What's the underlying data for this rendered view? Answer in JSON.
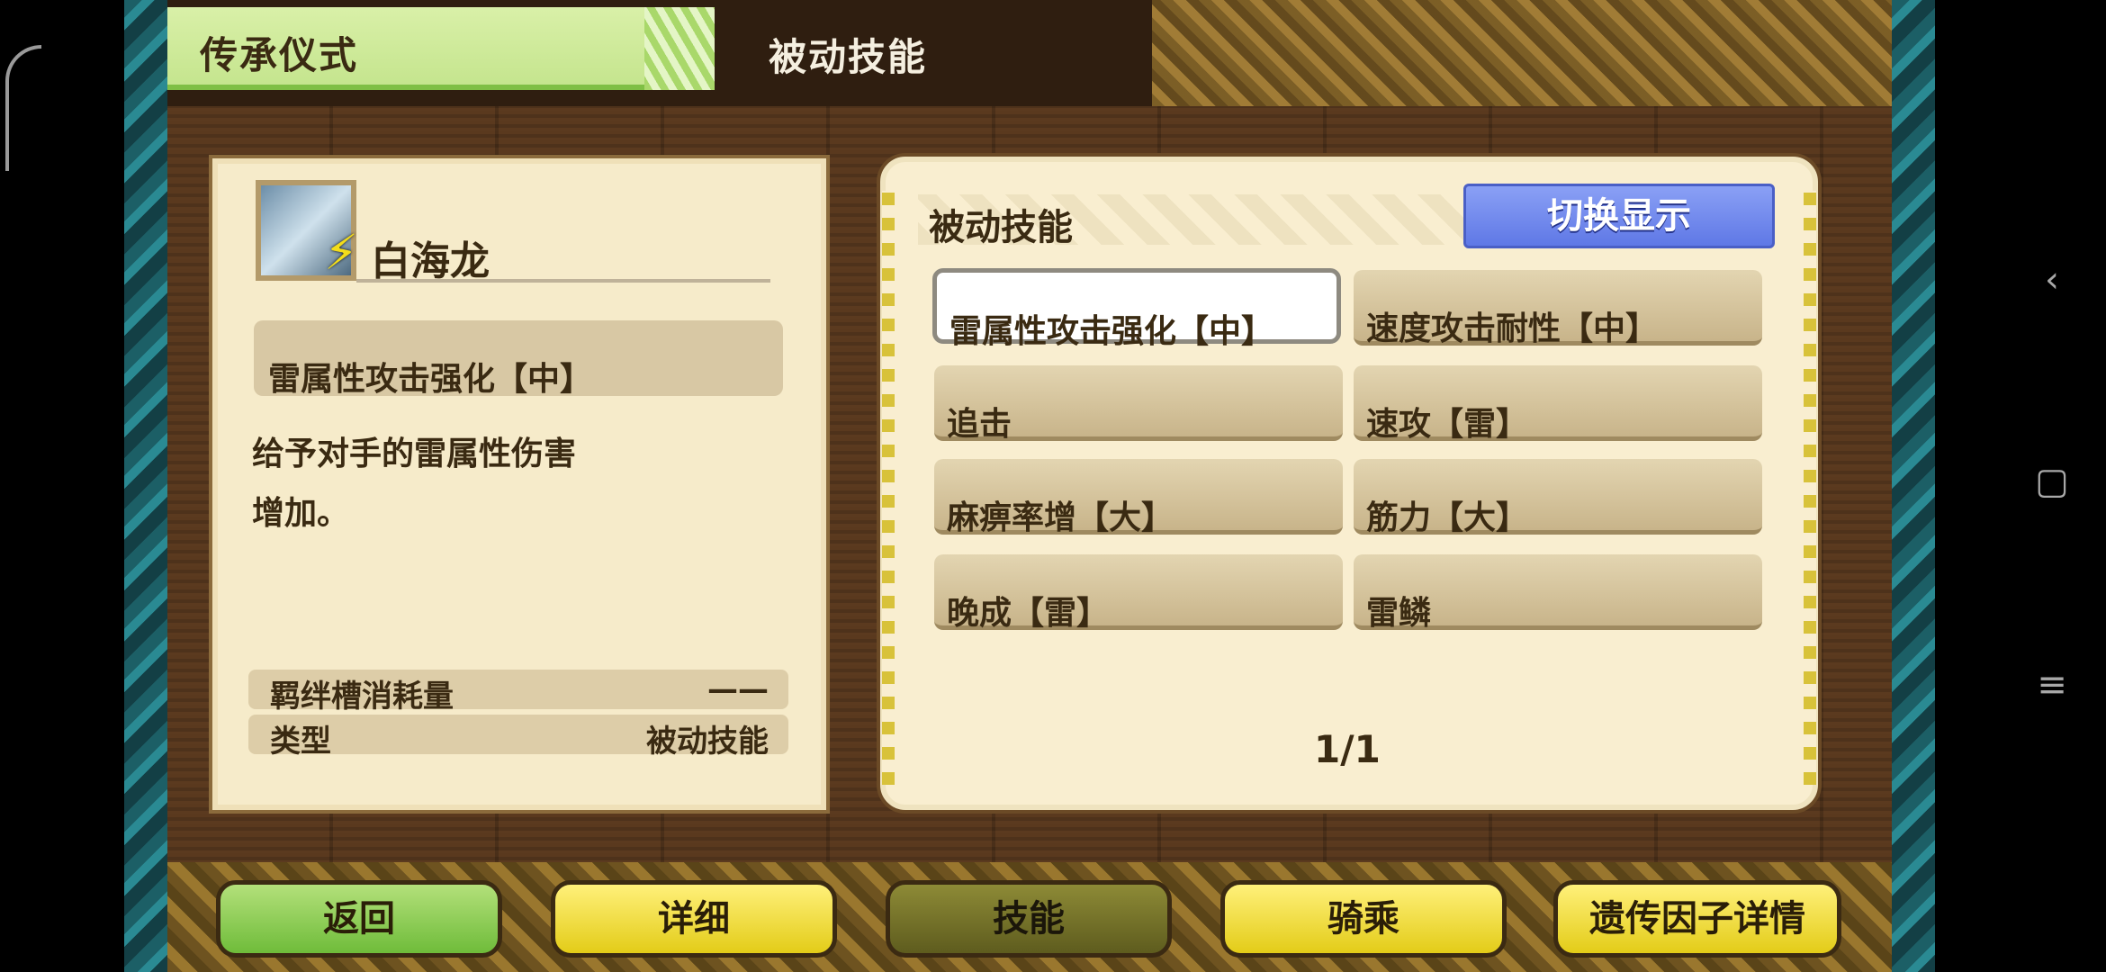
{
  "header": {
    "title": "传承仪式",
    "section": "被动技能"
  },
  "monster": {
    "name": "白海龙",
    "element_icon": "lightning-icon"
  },
  "detail": {
    "selected_skill": "雷属性攻击强化【中】",
    "description": "给予对手的雷属性伤害\n增加。",
    "stats": [
      {
        "label": "羁绊槽消耗量",
        "value": "——"
      },
      {
        "label": "类型",
        "value": "被动技能"
      }
    ]
  },
  "skill_panel": {
    "title": "被动技能",
    "switch_label": "切换显示",
    "skills": [
      "雷属性攻击强化【中】",
      "速度攻击耐性【中】",
      "追击",
      "速攻【雷】",
      "麻痹率增【大】",
      "筋力【大】",
      "晚成【雷】",
      "雷鳞"
    ],
    "selected_index": 0,
    "pager": "1/1"
  },
  "bottom_nav": {
    "back": "返回",
    "detail": "详细",
    "skill": "技能",
    "ride": "骑乘",
    "gene_detail": "遗传因子详情",
    "active": "技能"
  },
  "system_nav": {
    "back_icon": "back-chevron-icon",
    "home_icon": "home-square-icon",
    "menu_icon": "menu-lines-icon"
  }
}
